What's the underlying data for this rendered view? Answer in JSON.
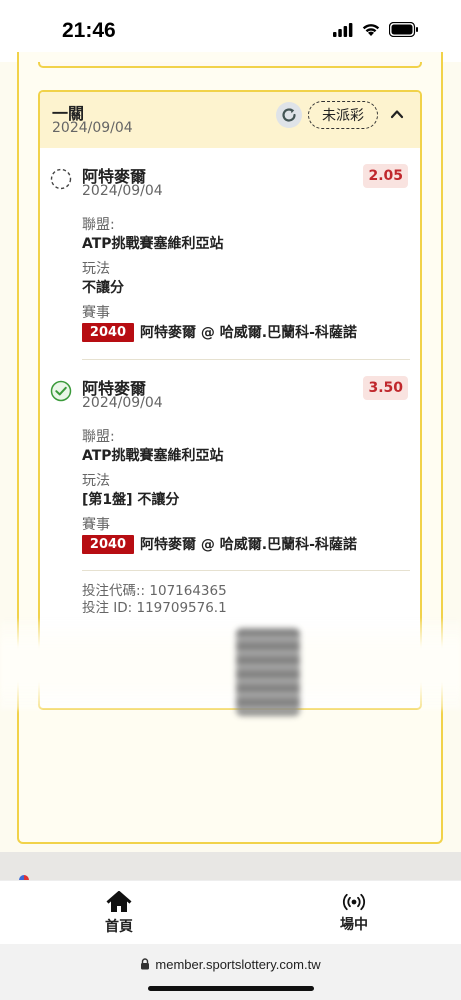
{
  "status_bar": {
    "time": "21:46"
  },
  "bet": {
    "type": "一關",
    "date": "2024/09/04",
    "status": "未派彩",
    "legs": [
      {
        "selection": "阿特麥爾",
        "date": "2024/09/04",
        "odds": "2.05",
        "league_label": "聯盟:",
        "league": "ATP挑戰賽塞維利亞站",
        "play_label": "玩法",
        "play": "不讓分",
        "event_label": "賽事",
        "event_code": "2040",
        "event_name": "阿特麥爾 @ 哈威爾.巴蘭科-科薩諾",
        "state": "pending"
      },
      {
        "selection": "阿特麥爾",
        "date": "2024/09/04",
        "odds": "3.50",
        "league_label": "聯盟:",
        "league": "ATP挑戰賽塞維利亞站",
        "play_label": "玩法",
        "play": "[第1盤] 不讓分",
        "event_label": "賽事",
        "event_code": "2040",
        "event_name": "阿特麥爾 @ 哈威爾.巴蘭科-科薩諾",
        "state": "won"
      }
    ],
    "bet_code_line": "投注代碼:: 107164365",
    "bet_id_line": "投注 ID: 119709576.1"
  },
  "tabbar": {
    "home_label": "首頁",
    "live_label": "場中"
  },
  "browser": {
    "url": "member.sportslottery.com.tw"
  },
  "colors": {
    "accent": "#f1d24a",
    "odds": "#c0282d",
    "event_code_bg": "#b70d12",
    "won": "#3a9a3a"
  }
}
